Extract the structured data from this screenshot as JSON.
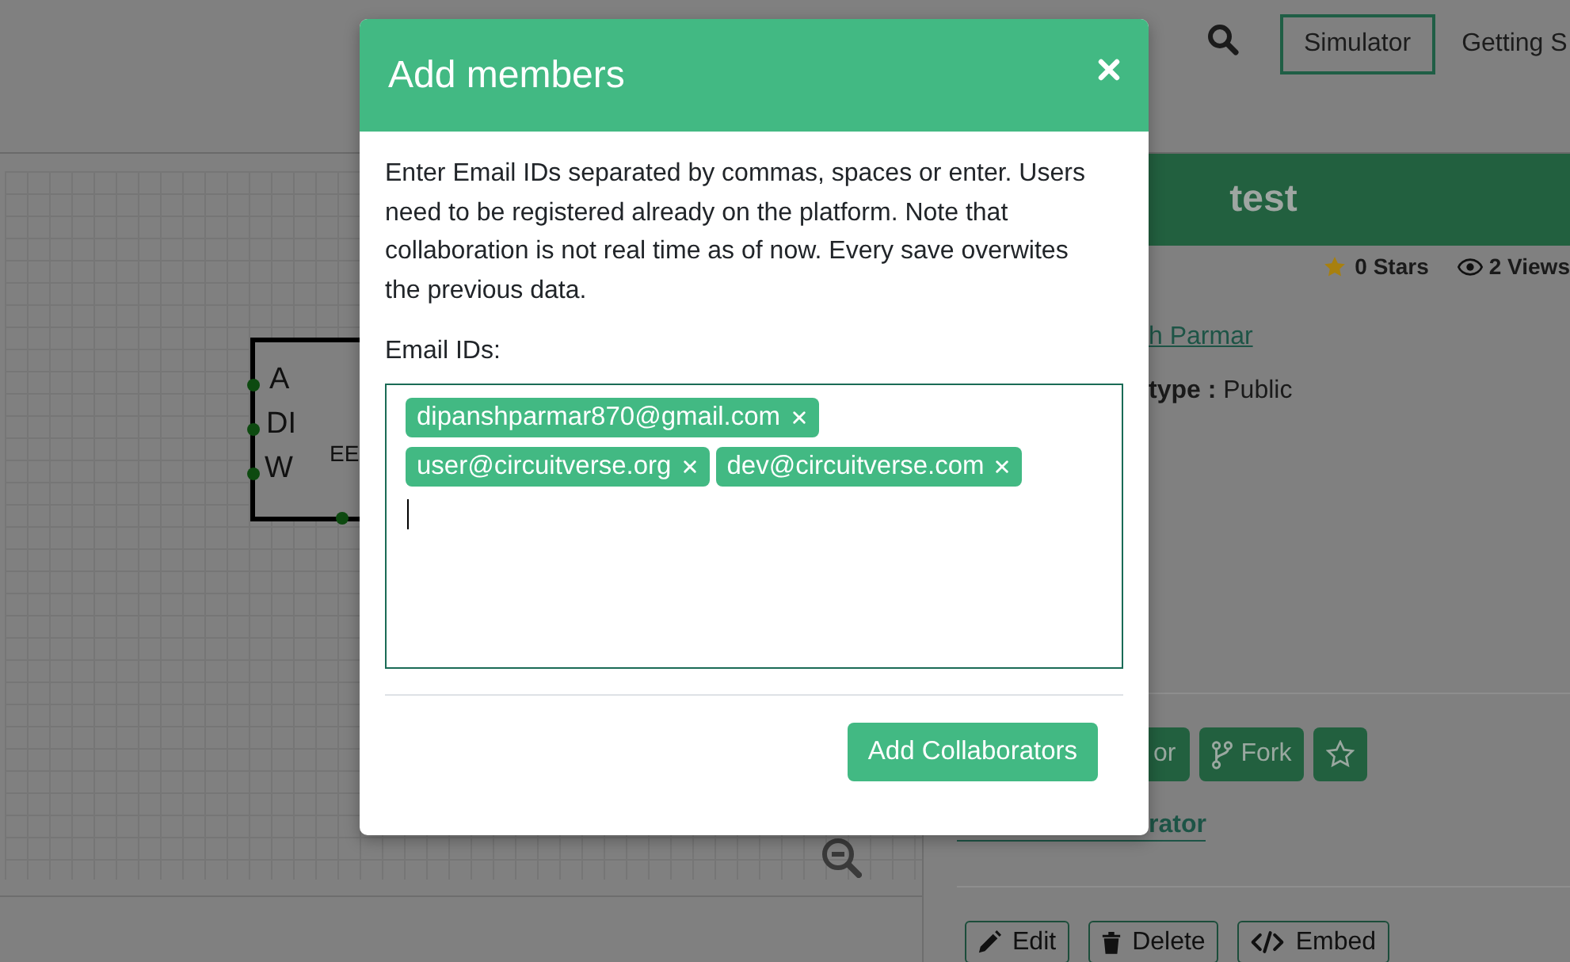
{
  "navbar": {
    "links": [
      {
        "label": "Simulator",
        "selected": true
      },
      {
        "label": "Getting S",
        "selected": false
      }
    ]
  },
  "canvas": {
    "component": {
      "pins": [
        "A",
        "DI",
        "W"
      ],
      "label": "EE"
    }
  },
  "project": {
    "title": "test",
    "stars_count": "0 Stars",
    "views_count": "2 Views",
    "author": "h Parmar",
    "project_type": "**type :** Public",
    "actions": [
      {
        "kind": "collaborator",
        "label": "or"
      },
      {
        "kind": "fork",
        "label": "Fork"
      },
      {
        "kind": "star"
      }
    ],
    "collaborator_link": "rator",
    "footer_actions": [
      {
        "kind": "edit",
        "label": "Edit"
      },
      {
        "kind": "delete",
        "label": "Delete"
      },
      {
        "kind": "embed",
        "label": "Embed"
      }
    ]
  },
  "modal": {
    "title": "Add members",
    "description": "Enter Email IDs separated by commas, spaces or enter. Users need to be registered already on the platform. Note that collaboration is not real time as of now. Every save overwites the previous data.",
    "field_label": "Email IDs:",
    "field": {
      "focused": true,
      "tags": [
        "dipanshparmar870@gmail.com",
        "user@circuitverse.org",
        "dev@circuitverse.com"
      ]
    },
    "submit": "Add Collaborators"
  }
}
